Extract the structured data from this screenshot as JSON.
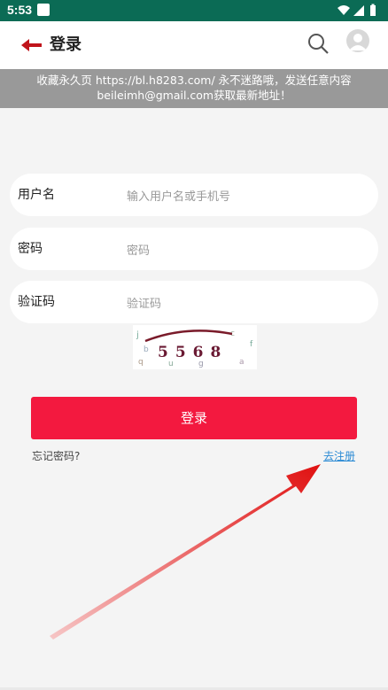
{
  "status": {
    "time": "5:53"
  },
  "header": {
    "title": "登录"
  },
  "notice": {
    "line1": "收藏永久页 https://bl.h8283.com/ 永不迷路哦，发送任意内容",
    "line2": "beileimh@gmail.com获取最新地址！"
  },
  "form": {
    "username_label": "用户名",
    "username_placeholder": "输入用户名或手机号",
    "password_label": "密码",
    "password_placeholder": "密码",
    "captcha_label": "验证码",
    "captcha_placeholder": "验证码",
    "captcha_text": "5568"
  },
  "actions": {
    "login_label": "登录",
    "forgot_label": "忘记密码?",
    "register_label": "去注册"
  },
  "colors": {
    "statusbar": "#0b6b55",
    "accent": "#f3193f",
    "link": "#2a8ad4",
    "notice_bg": "#999999"
  }
}
